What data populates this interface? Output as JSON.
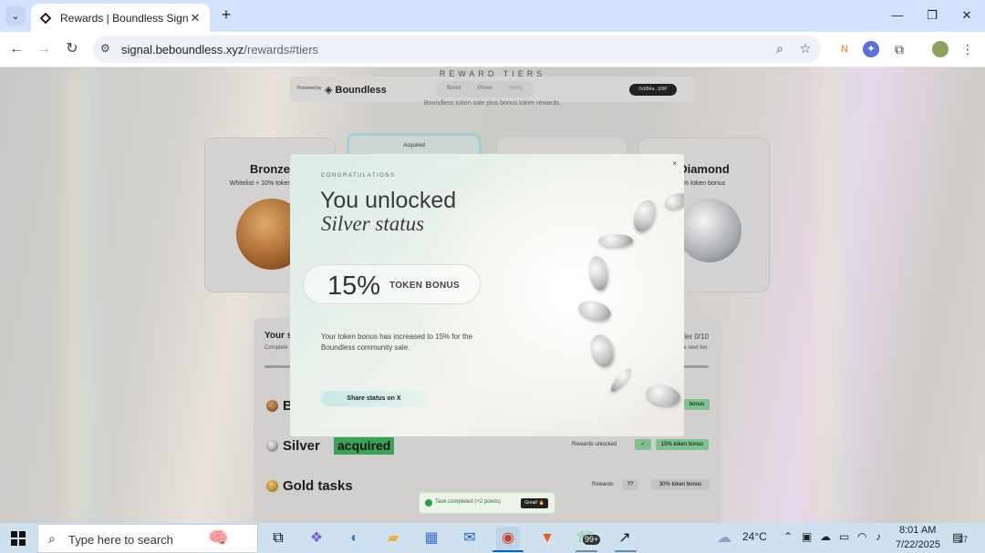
{
  "browser": {
    "tab_title": "Rewards | Boundless Signal",
    "tab_close": "✕",
    "new_tab": "+",
    "url_host": "signal.beboundless.xyz",
    "url_path": "/rewards#tiers",
    "window_controls": {
      "minimize": "—",
      "maximize": "❐",
      "close": "✕"
    }
  },
  "page": {
    "header_title": "REWARD TIERS",
    "powered_by": "Powered by",
    "brand": "Boundless",
    "nav": [
      "Boost",
      "Prove",
      "Verify"
    ],
    "wallet": "0x5B4a...5f9F",
    "subtitle": "Boundless token sale plus bonus token rewards.",
    "acquired_label": "Acquired",
    "tiers": [
      {
        "name": "Bronze",
        "desc": "Whitelist + 10% token bonus"
      },
      {
        "name": "Diamond",
        "desc": "% token bonus"
      }
    ],
    "tasks_panel": {
      "title": "Your s",
      "subtitle": "Complete",
      "count": "tier 0/10",
      "next": "e next tier.",
      "rows": [
        {
          "name": "B",
          "badge": "",
          "rewards_label": "",
          "chip1": "",
          "chip2": "bonus"
        },
        {
          "name": "Silver",
          "badge": "acquired",
          "rewards_label": "Rewards unlocked",
          "chip1": "✓",
          "chip2": "15% token bonus"
        },
        {
          "name": "Gold tasks",
          "badge": "",
          "rewards_label": "Rewards",
          "chip1": "??",
          "chip2": "30% token bonus"
        }
      ]
    },
    "toast": {
      "message": "Task completed (+2 points)",
      "button": "Great! 🔥"
    }
  },
  "modal": {
    "close": "×",
    "eyebrow": "CONGRATULATIONS",
    "heading": "You unlocked",
    "status": "Silver status",
    "bonus_value": "15%",
    "bonus_label": "TOKEN BONUS",
    "body": "Your token bonus has increased to 15% for the Boundless community sale.",
    "share_button": "Share status on X"
  },
  "taskbar": {
    "search_placeholder": "Type here to search",
    "whatsapp_badge": "99+",
    "weather": "24°C",
    "time": "8:01 AM",
    "date": "7/22/2025",
    "notifications": "27"
  },
  "colors": {
    "accent_green": "#3aa356",
    "share_button": "#c8e8e6",
    "tabbar": "#d3e3fd",
    "taskbar": "#cfe0ef"
  }
}
